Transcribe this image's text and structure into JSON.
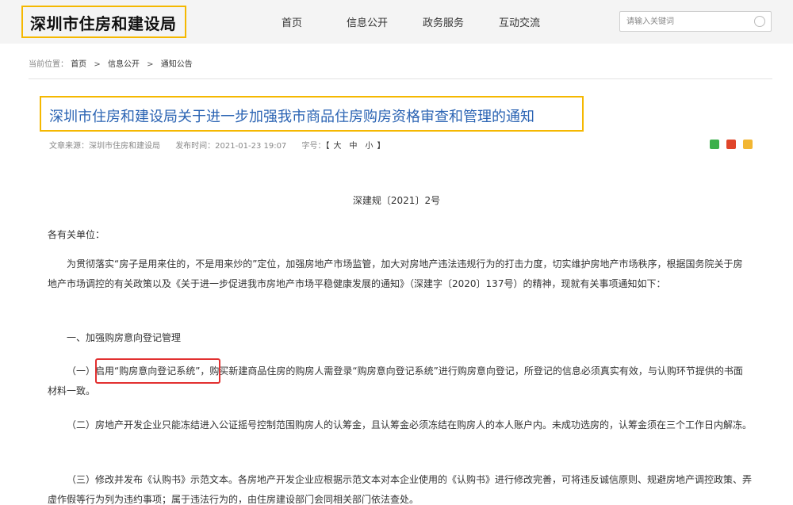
{
  "header": {
    "logo": "深圳市住房和建设局",
    "nav": [
      "首页",
      "信息公开",
      "政务服务",
      "互动交流"
    ],
    "search_placeholder": "请输入关键词"
  },
  "breadcrumb": {
    "prefix": "当前位置：",
    "items": [
      "首页",
      "信息公开",
      "通知公告"
    ],
    "separator": ">"
  },
  "article": {
    "title": "深圳市住房和建设局关于进一步加强我市商品住房购房资格审查和管理的通知",
    "meta": {
      "source": "文章来源：深圳市住房和建设局",
      "date": "发布时间：2021-01-23 19:07",
      "size_label": "字号：",
      "size_open": "【",
      "sizes": [
        "大",
        "中",
        "小"
      ],
      "size_close": "】"
    },
    "doc_no": "深建规〔2021〕2号",
    "salutation": "各有关单位：",
    "intro": "为贯彻落实“房子是用来住的，不是用来炒的”定位，加强房地产市场监管，加大对房地产违法违规行为的打击力度，切实维护房地产市场秩序，根据国务院关于房地产市场调控的有关政策以及《关于进一步促进我市房地产市场平稳健康发展的通知》（深建字〔2020〕137号）的精神，现就有关事项通知如下：",
    "section1": "一、加强购房意向登记管理",
    "p1": "（一）启用“购房意向登记系统”，购买新建商品住房的购房人需登录“购房意向登记系统”进行购房意向登记，所登记的信息必须真实有效，与认购环节提供的书面材料一致。",
    "p2": "（二）房地产开发企业只能冻结进入公证摇号控制范围购房人的认筹金，且认筹金必须冻结在购房人的本人账户内。未成功选房的，认筹金须在三个工作日内解冻。",
    "p3": "（三）修改并发布《认购书》示范文本。各房地产开发企业应根据示范文本对本企业使用的《认购书》进行修改完善，可将违反诚信原则、规避房地产调控政策、弄虚作假等行为列为违约事项；属于违法行为的，由住房建设部门会同相关部门依法查处。"
  },
  "colors": {
    "title_blue": "#2a63b3",
    "highlight_yellow": "#f5b800",
    "highlight_red": "#e23030"
  }
}
